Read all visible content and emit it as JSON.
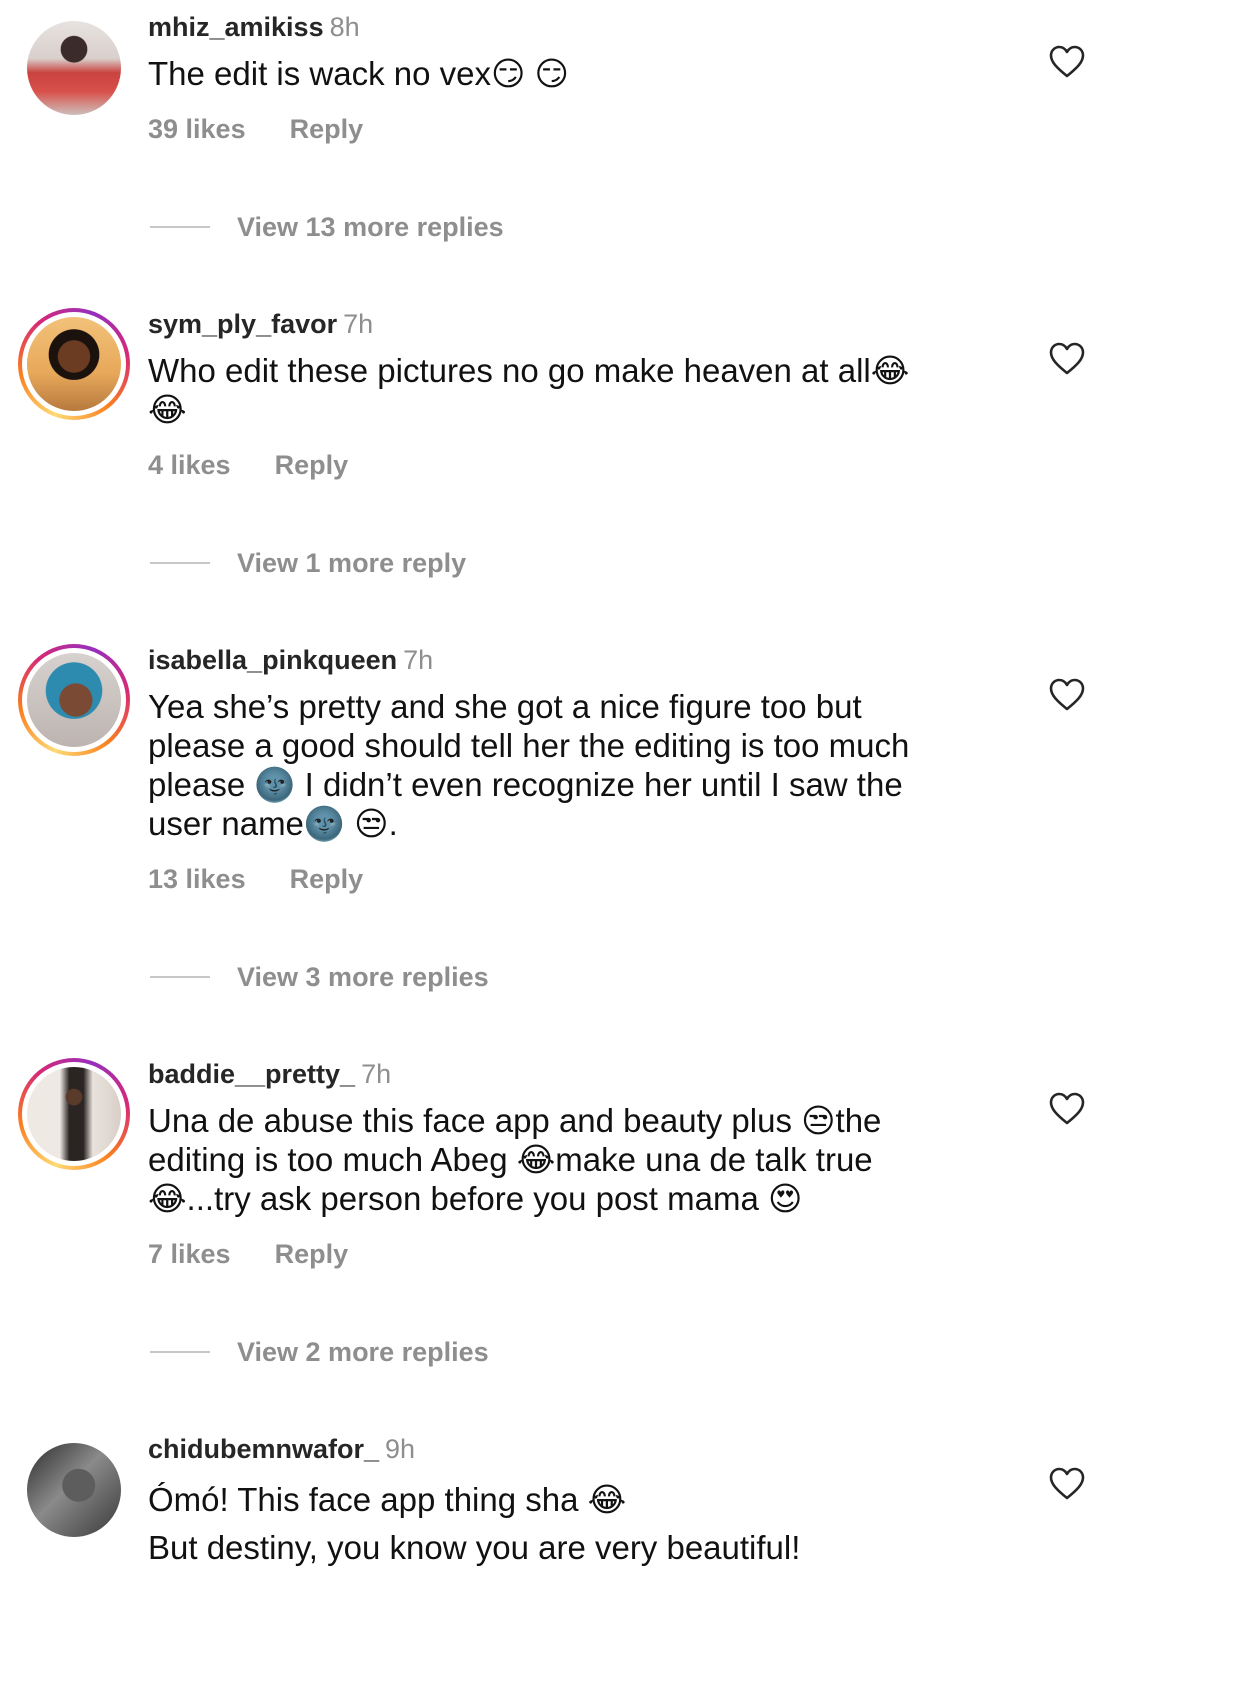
{
  "comments": [
    {
      "username": "mhiz_amikiss",
      "time": "8h",
      "lines": [
        "The edit is wack no vex😏 😏"
      ],
      "likes": "39 likes",
      "reply": "Reply",
      "view_replies": "View 13 more replies",
      "avatar": "profile-photo",
      "story_ring": false
    },
    {
      "username": "sym_ply_favor",
      "time": "7h",
      "lines": [
        "Who edit these pictures no go make heaven at all😂",
        "😂"
      ],
      "likes": "4 likes",
      "reply": "Reply",
      "view_replies": "View 1 more reply",
      "avatar": "profile-photo",
      "story_ring": true
    },
    {
      "username": "isabella_pinkqueen",
      "time": "7h",
      "lines": [
        "Yea she’s pretty and she got a nice figure too but",
        "please a good should tell her the editing is too much",
        "please 🌚 I didn’t even recognize her until I saw the",
        "user name🌚 😒."
      ],
      "likes": "13 likes",
      "reply": "Reply",
      "view_replies": "View 3 more replies",
      "avatar": "profile-photo",
      "story_ring": true
    },
    {
      "username": "baddie__pretty_",
      "time": "7h",
      "lines": [
        "Una de abuse this face app and beauty plus 😒the",
        "editing is too much Abeg 😂make una de talk true",
        "😂...try ask person before you post mama 😍"
      ],
      "likes": "7 likes",
      "reply": "Reply",
      "view_replies": "View 2 more replies",
      "avatar": "profile-photo",
      "story_ring": true
    },
    {
      "username": "chidubemnwafor_",
      "time": "9h",
      "lines": [
        "Ómó! This face app thing sha 😂",
        "But destiny, you know you are very beautiful!"
      ],
      "avatar": "profile-photo",
      "story_ring": false
    }
  ],
  "icons": {
    "like": "heart-outline-icon"
  },
  "colors": {
    "primary_text": "#111111",
    "secondary_text": "#8e8e8e",
    "divider": "#c7c7c7"
  }
}
